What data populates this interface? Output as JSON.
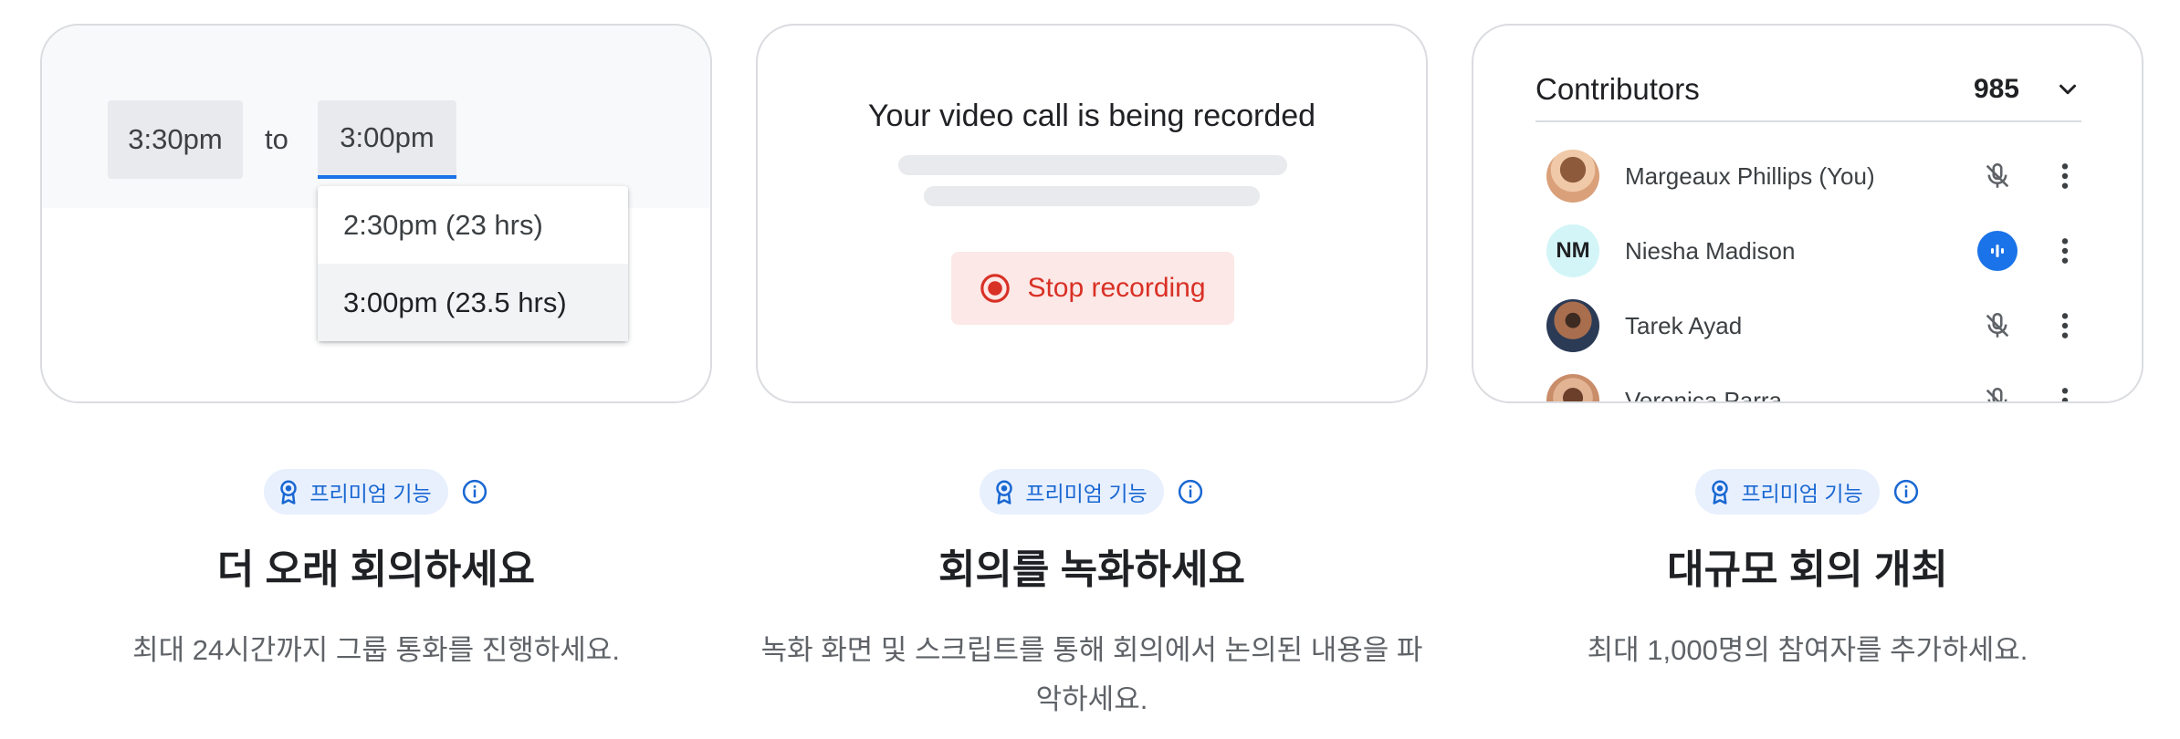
{
  "features": [
    {
      "card": {
        "time_from": "3:30pm",
        "to_label": "to",
        "time_to": "3:00pm",
        "options": [
          {
            "label": "2:30pm (23 hrs)",
            "selected": false
          },
          {
            "label": "3:00pm (23.5 hrs)",
            "selected": true
          }
        ]
      },
      "badge": "프리미엄 기능",
      "title": "더 오래 회의하세요",
      "description": "최대 24시간까지 그룹 통화를 진행하세요."
    },
    {
      "card": {
        "recording_title": "Your video call is being recorded",
        "stop_label": "Stop recording"
      },
      "badge": "프리미엄 기능",
      "title": "회의를 녹화하세요",
      "description": "녹화 화면 및 스크립트를 통해 회의에서 논의된 내용을 파악하세요."
    },
    {
      "card": {
        "header_title": "Contributors",
        "count": "985",
        "participants": [
          {
            "name": "Margeaux Phillips (You)",
            "initials": "",
            "mic": "muted"
          },
          {
            "name": "Niesha Madison",
            "initials": "NM",
            "mic": "speaking"
          },
          {
            "name": "Tarek Ayad",
            "initials": "",
            "mic": "muted"
          },
          {
            "name": "Veronica Parra",
            "initials": "",
            "mic": "muted"
          }
        ]
      },
      "badge": "프리미엄 기능",
      "title": "대규모 회의 개최",
      "description": "최대 1,000명의 참여자를 추가하세요."
    }
  ],
  "icons": {
    "badge": "award-ribbon-icon",
    "info": "info-icon",
    "record": "record-icon",
    "chevron": "chevron-down-icon",
    "mic_muted": "mic-off-icon",
    "mic_speaking": "speaking-icon",
    "more": "more-vert-icon"
  },
  "colors": {
    "accent": "#1a73e8",
    "badge_bg": "#e8f0fe",
    "record_red": "#d93025",
    "record_bg": "#fce8e6"
  }
}
